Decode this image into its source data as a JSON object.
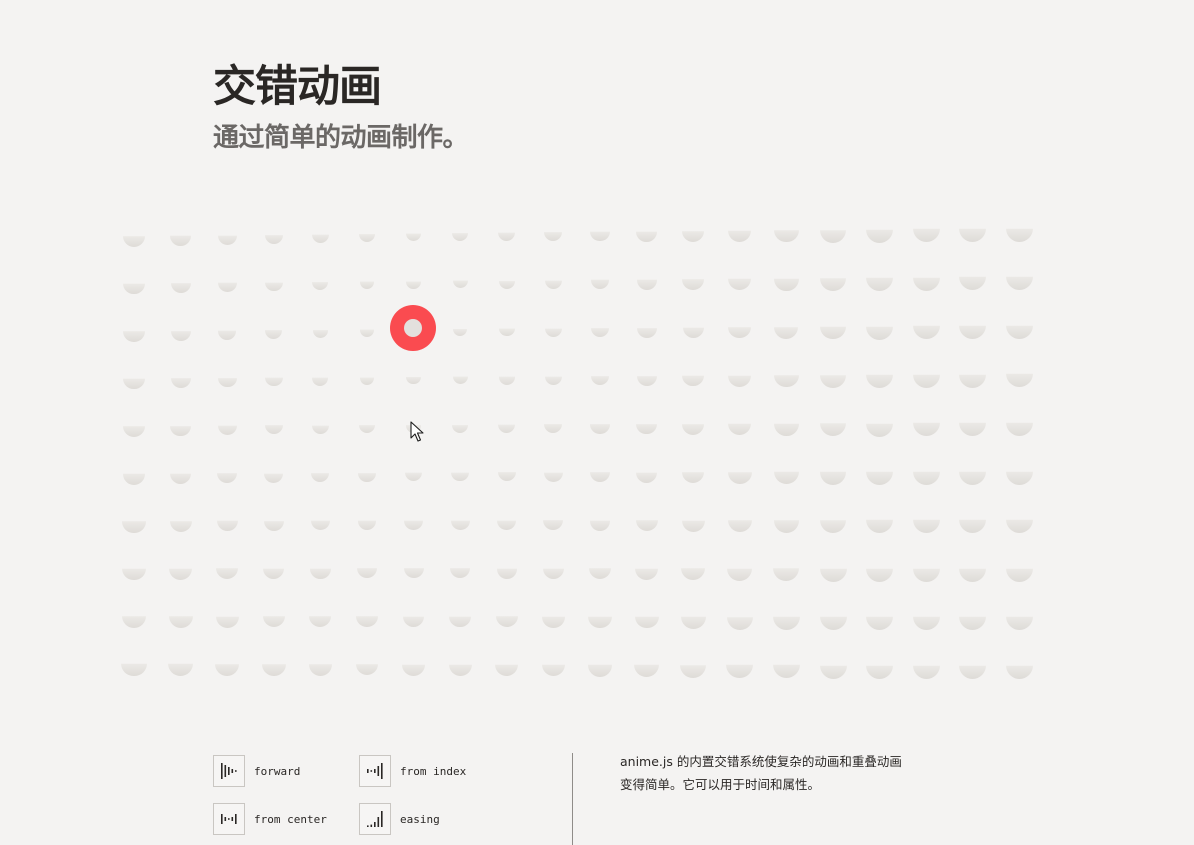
{
  "header": {
    "title": "交错动画",
    "subtitle": "通过简单的动画制作。"
  },
  "options": [
    {
      "label": "forward",
      "icon": "stagger-forward-icon"
    },
    {
      "label": "from index",
      "icon": "stagger-from-index-icon"
    },
    {
      "label": "from center",
      "icon": "stagger-from-center-icon"
    },
    {
      "label": "easing",
      "icon": "stagger-easing-icon"
    }
  ],
  "description": {
    "line1": "anime.js 的内置交错系统使复杂的动画和重叠动画",
    "line2": "变得简单。它可以用于时间和属性。"
  },
  "colors": {
    "background": "#f4f3f2",
    "accent": "#fa4b50",
    "dot_shade": "#dedbd7",
    "text": "#2a2725",
    "subtitle": "#6b6866"
  },
  "grid": {
    "rows": 10,
    "columns": 20
  }
}
